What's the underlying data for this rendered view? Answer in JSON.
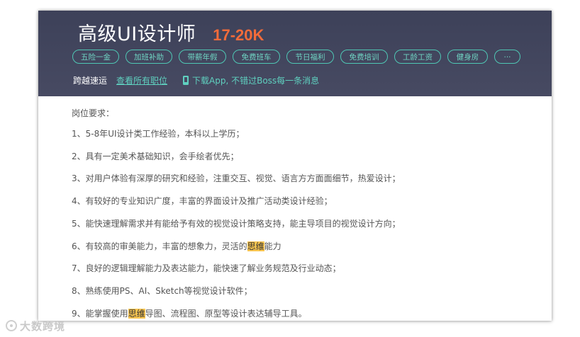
{
  "header": {
    "job_title": "高级UI设计师",
    "salary": "17-20K",
    "tags": [
      "五险一金",
      "加班补助",
      "带薪年假",
      "免费班车",
      "节日福利",
      "免费培训",
      "工龄工资",
      "健身房",
      "···"
    ],
    "company": "跨越速运",
    "view_all_jobs": "查看所有职位",
    "app_promo": "下载App, 不错过Boss每一条消息"
  },
  "requirements": {
    "heading": "岗位要求：",
    "items": [
      {
        "pre": "1、5-8年UI设计类工作经验，本科以上学历；",
        "hl": "",
        "post": ""
      },
      {
        "pre": "2、具有一定美术基础知识，会手绘者优先；",
        "hl": "",
        "post": ""
      },
      {
        "pre": "3、对用户体验有深厚的研究和经验，注重交互、视觉、语言方方面面细节，热爱设计；",
        "hl": "",
        "post": ""
      },
      {
        "pre": "4、有较好的专业知识广度，丰富的界面设计及推广活动类设计经验；",
        "hl": "",
        "post": ""
      },
      {
        "pre": "5、能快速理解需求并有能给予有效的视觉设计策略支持，能主导项目的视觉设计方向；",
        "hl": "",
        "post": ""
      },
      {
        "pre": "6、有较高的审美能力，丰富的想象力，灵活的",
        "hl": "思维",
        "post": "能力"
      },
      {
        "pre": "7、良好的逻辑理解能力及表达能力，能快速了解业务规范及行业动态；",
        "hl": "",
        "post": ""
      },
      {
        "pre": "8、熟练使用PS、AI、Sketch等视觉设计软件；",
        "hl": "",
        "post": ""
      },
      {
        "pre": "9、能掌握使用",
        "hl": "思维",
        "post": "导图、流程图、原型等设计表达辅导工具。"
      }
    ]
  },
  "watermark": "大数跨境",
  "colors": {
    "header_bg": "#42465e",
    "accent_teal": "#5fd0bf",
    "salary_orange": "#f26b3a",
    "highlight": "#f9c550"
  }
}
